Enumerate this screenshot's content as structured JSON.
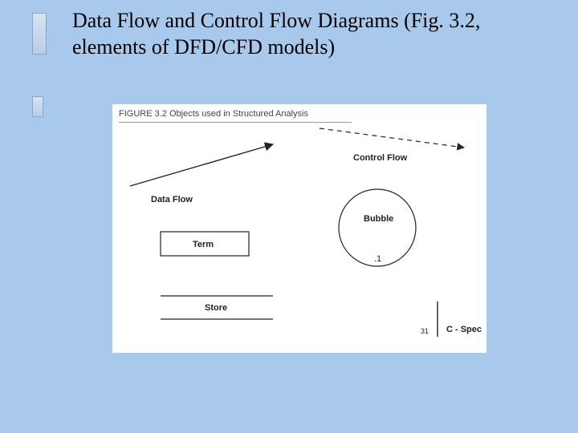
{
  "title": "Data Flow and Control Flow Diagrams (Fig. 3.2, elements of DFD/CFD models)",
  "figure": {
    "caption": "FIGURE 3.2  Objects used in Structured Analysis",
    "labels": {
      "data_flow": "Data Flow",
      "control_flow": "Control Flow",
      "term": "Term",
      "bubble": "Bubble",
      "bubble_index": ".1",
      "store": "Store",
      "cspec": "C - Spec",
      "page": "31"
    }
  }
}
